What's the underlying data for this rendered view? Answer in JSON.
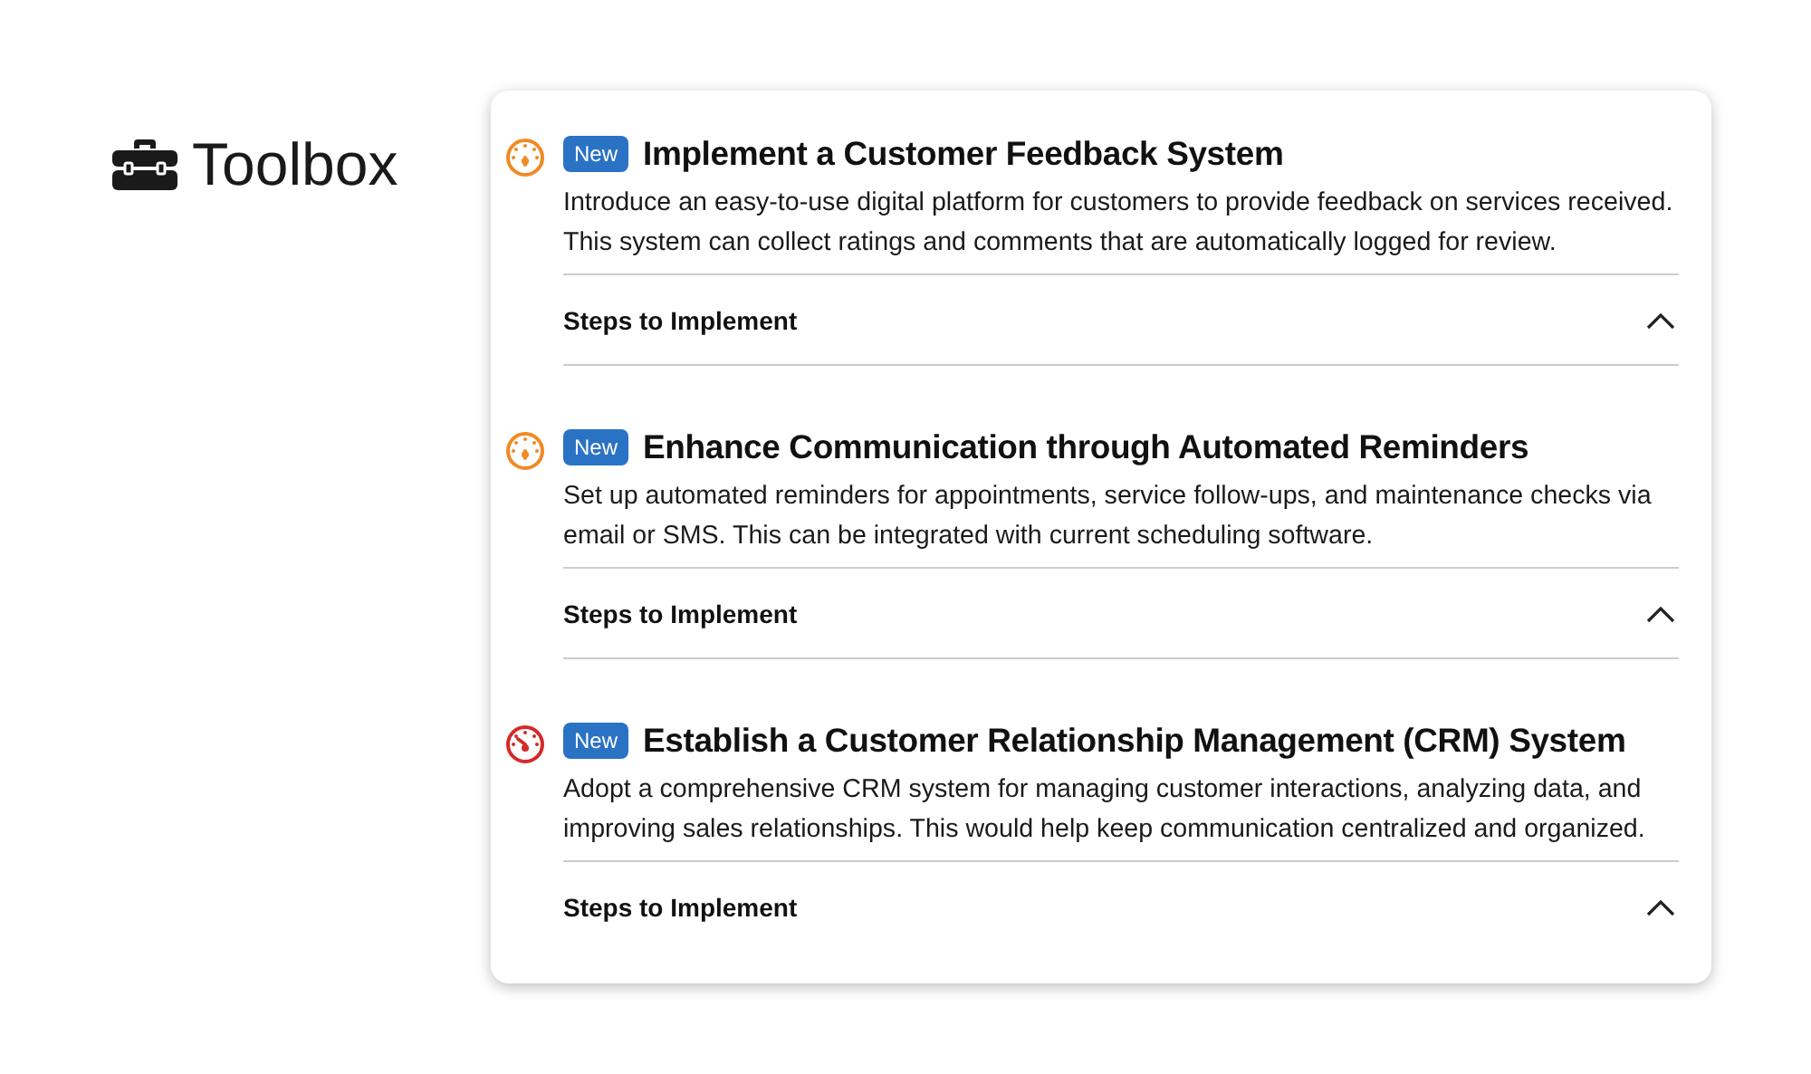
{
  "brand": {
    "title": "Toolbox"
  },
  "items": [
    {
      "kind": "medium",
      "color": "#f08a24",
      "badge": "New",
      "title": "Implement a Customer Feedback System",
      "description": "Introduce an easy-to-use digital platform for customers to provide feedback on services received. This system can collect ratings and comments that are automatically logged for review.",
      "section": {
        "label": "Steps to Implement",
        "expanded": true
      }
    },
    {
      "kind": "medium",
      "color": "#f08a24",
      "badge": "New",
      "title": "Enhance Communication through Automated Reminders",
      "description": "Set up automated reminders for appointments, service follow-ups, and maintenance checks via email or SMS. This can be integrated with current scheduling software.",
      "section": {
        "label": "Steps to Implement",
        "expanded": true
      }
    },
    {
      "kind": "high",
      "color": "#d42a2a",
      "badge": "New",
      "title": "Establish a Customer Relationship Management (CRM) System",
      "description": "Adopt a comprehensive CRM system for managing customer interactions, analyzing data, and improving sales relationships. This would help keep communication centralized and organized.",
      "section": {
        "label": "Steps to Implement",
        "expanded": true
      }
    }
  ]
}
